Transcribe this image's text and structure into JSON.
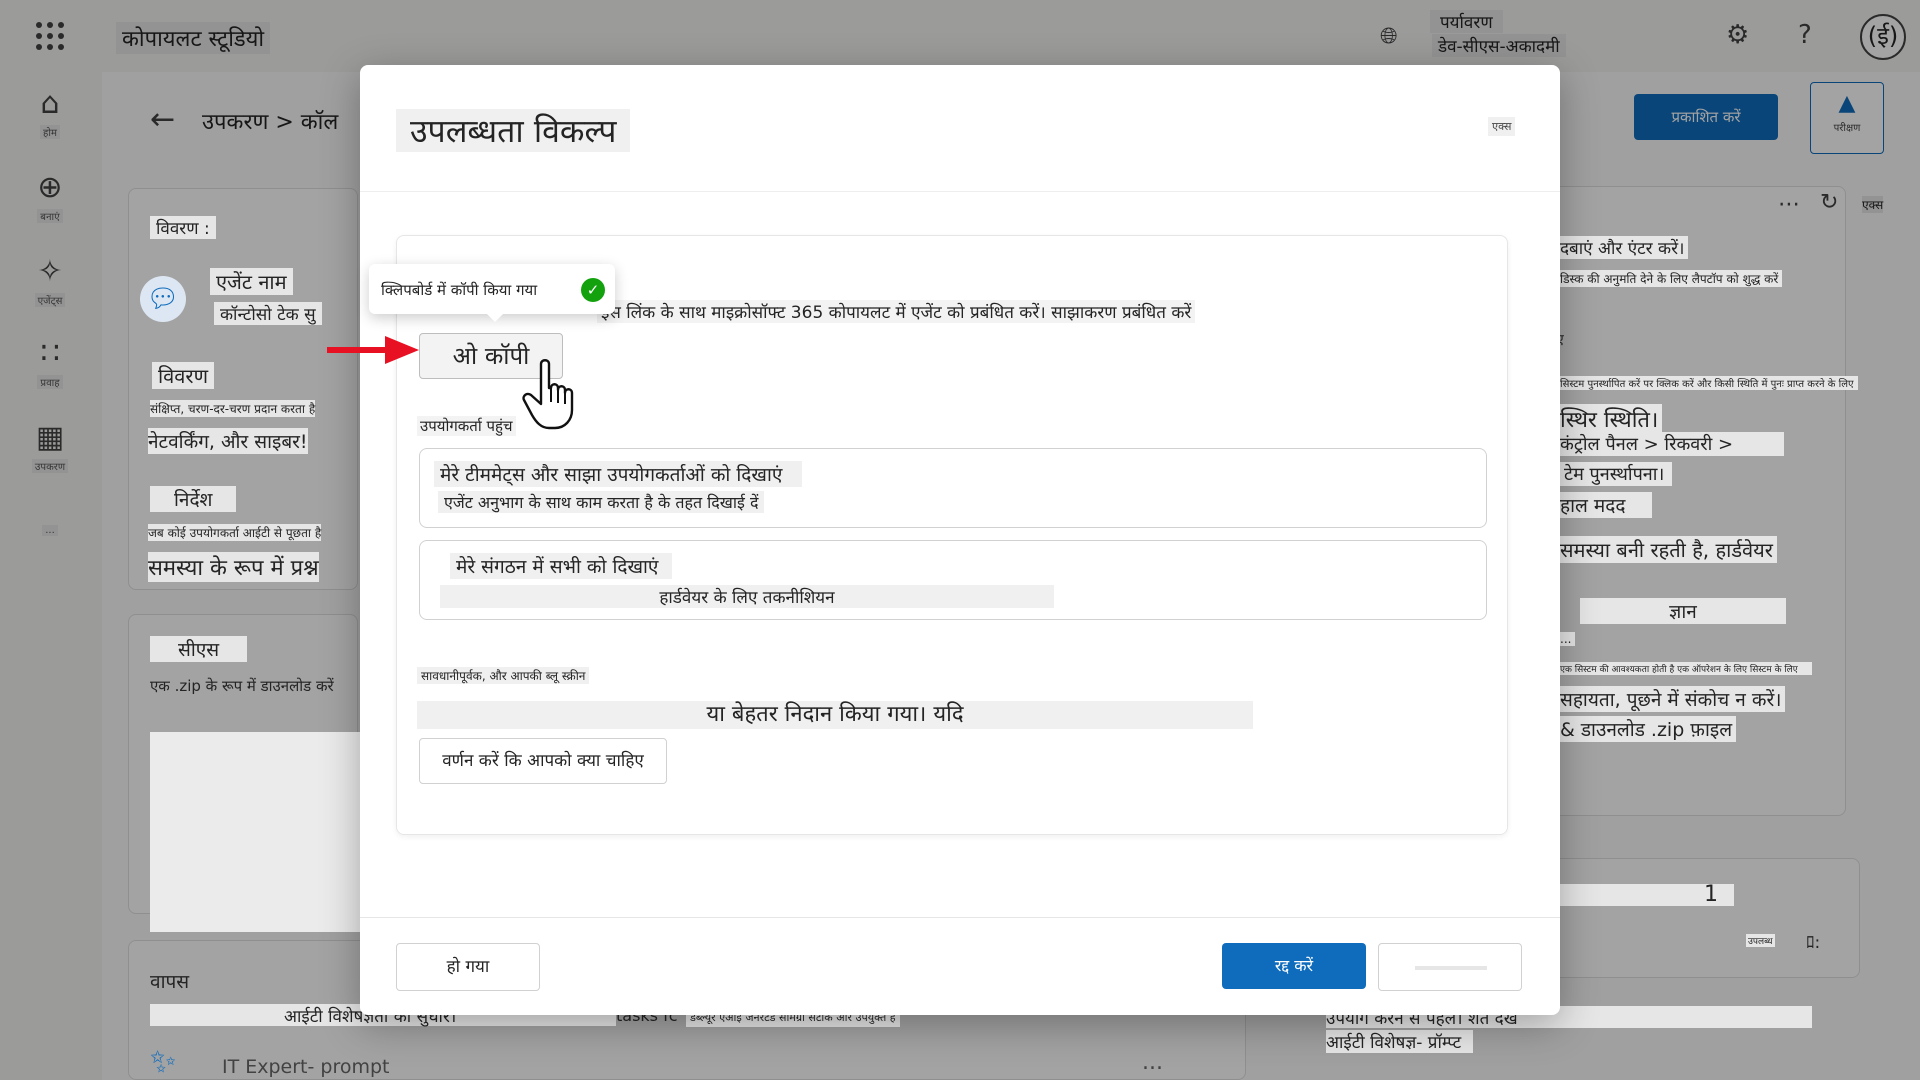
{
  "topbar": {
    "app_title": "कोपायलट स्टूडियो",
    "env_label": "पर्यावरण",
    "env_name": "डेव-सीएस-अकादमी",
    "avatar": "(ई)",
    "icons": [
      "waffle-icon",
      "globe-icon",
      "gear-icon",
      "help-icon"
    ]
  },
  "rail": {
    "items": [
      {
        "label": "होम",
        "icon": "home-icon"
      },
      {
        "label": "बनाएं",
        "icon": "plus-circle-icon"
      },
      {
        "label": "एजेंट्स",
        "icon": "agents-icon"
      },
      {
        "label": "प्रवाह",
        "icon": "flow-icon"
      },
      {
        "label": "उपकरण",
        "icon": "tools-icon"
      },
      {
        "label": "...",
        "icon": "more-icon"
      }
    ]
  },
  "page": {
    "breadcrumb": "उपकरण > कॉल",
    "publish_label": "प्रकाशित करें",
    "test_label": "परीक्षण",
    "right_header_x": "एक्स",
    "left": {
      "details_label": "विवरण :",
      "agent_name_label": "एजेंट नाम",
      "agent_name_value": "कॉन्टोसो टेक सु",
      "description_label": "विवरण",
      "description_small": "संक्षिप्त, चरण-दर-चरण प्रदान करता है",
      "description_big": "नेटवर्किंग, और साइबर!",
      "instructions_label": "निर्देश",
      "instructions_small": "जब कोई उपयोगकर्ता आईटी से पूछता है",
      "instructions_big": "समस्या के रूप में प्रश्न",
      "cs_label": "सीएस",
      "cs_text": "एक .zip के रूप में डाउनलोड करें",
      "back_label": "वापस",
      "improve_text": "आईटी विशेषज्ञता को सुधारें।",
      "tasks_text": "tasks fc",
      "prompt_name": "IT Expert- prompt",
      "more": "..."
    },
    "right": {
      "lines": [
        "दबाएं और एंटर करें।",
        "डिस्क की अनुमति देने के लिए लैपटॉप को शुद्ध करें",
        "ए",
        "सिस्टम पुनर्स्थापित करें पर क्लिक करें और किसी स्थिति में पुनः प्राप्त करने के लिए",
        "स्थिर स्थिति।",
        "कंट्रोल पैनल > रिकवरी >",
        "टेम पुनर्स्थापना।",
        "हाल मदद",
        "समस्या बनी रहती है, हार्डवेयर",
        "ज्ञान",
        "...",
        "एक सिस्टम की आवश्यकता होती है एक ऑपरेशन के लिए सिस्टम के लिए",
        "सहायता, पूछने में संकोच न करें।",
        "& डाउनलोड .zip फ़ाइल"
      ],
      "count": "1",
      "count_sub": "उपलब्ध",
      "toggle": "ﾛ:"
    },
    "bottom_strips": {
      "ai_notice": "डब्ल्यूर एआई जनरेटेड सामग्री सटीक और उपयुक्त है",
      "terms": "उपयोग करने से पहले। शर्तें देखें",
      "prompt": "आईटी विशेषज्ञ- प्रॉम्प्ट"
    }
  },
  "dialog": {
    "title": "उपलब्धता विकल्प",
    "close_label": "एक्स",
    "share_text": "इस लिंक के साथ माइक्रोसॉफ्ट 365 कोपायलट में एजेंट को प्रबंधित करें। साझाकरण प्रबंधित करें",
    "copy_label": "ओ कॉपी",
    "tooltip_text": "क्लिपबोर्ड में कॉपी किया गया",
    "access_label": "उपयोगकर्ता पहुंच",
    "options": [
      {
        "title": "मेरे टीममेट्स और साझा उपयोगकर्ताओं को दिखाएं",
        "subtitle": "एजेंट अनुभाग के साथ काम करता है के तहत दिखाई दें"
      },
      {
        "title": "मेरे संगठन में सभी को दिखाएं",
        "subtitle": "हार्डवेयर के लिए तकनीशियन"
      }
    ],
    "warn_small": "सावधानीपूर्वक, और आपकी ब्लू स्क्रीन",
    "warn_big": "या बेहतर निदान किया गया। यदि",
    "describe_label": "वर्णन करें कि आपको क्या चाहिए",
    "done_label": "हो गया",
    "cancel_label": "रद्द करें"
  },
  "colors": {
    "accent": "#0f6cbd",
    "success": "#13a10e",
    "arrow": "#e81123"
  }
}
